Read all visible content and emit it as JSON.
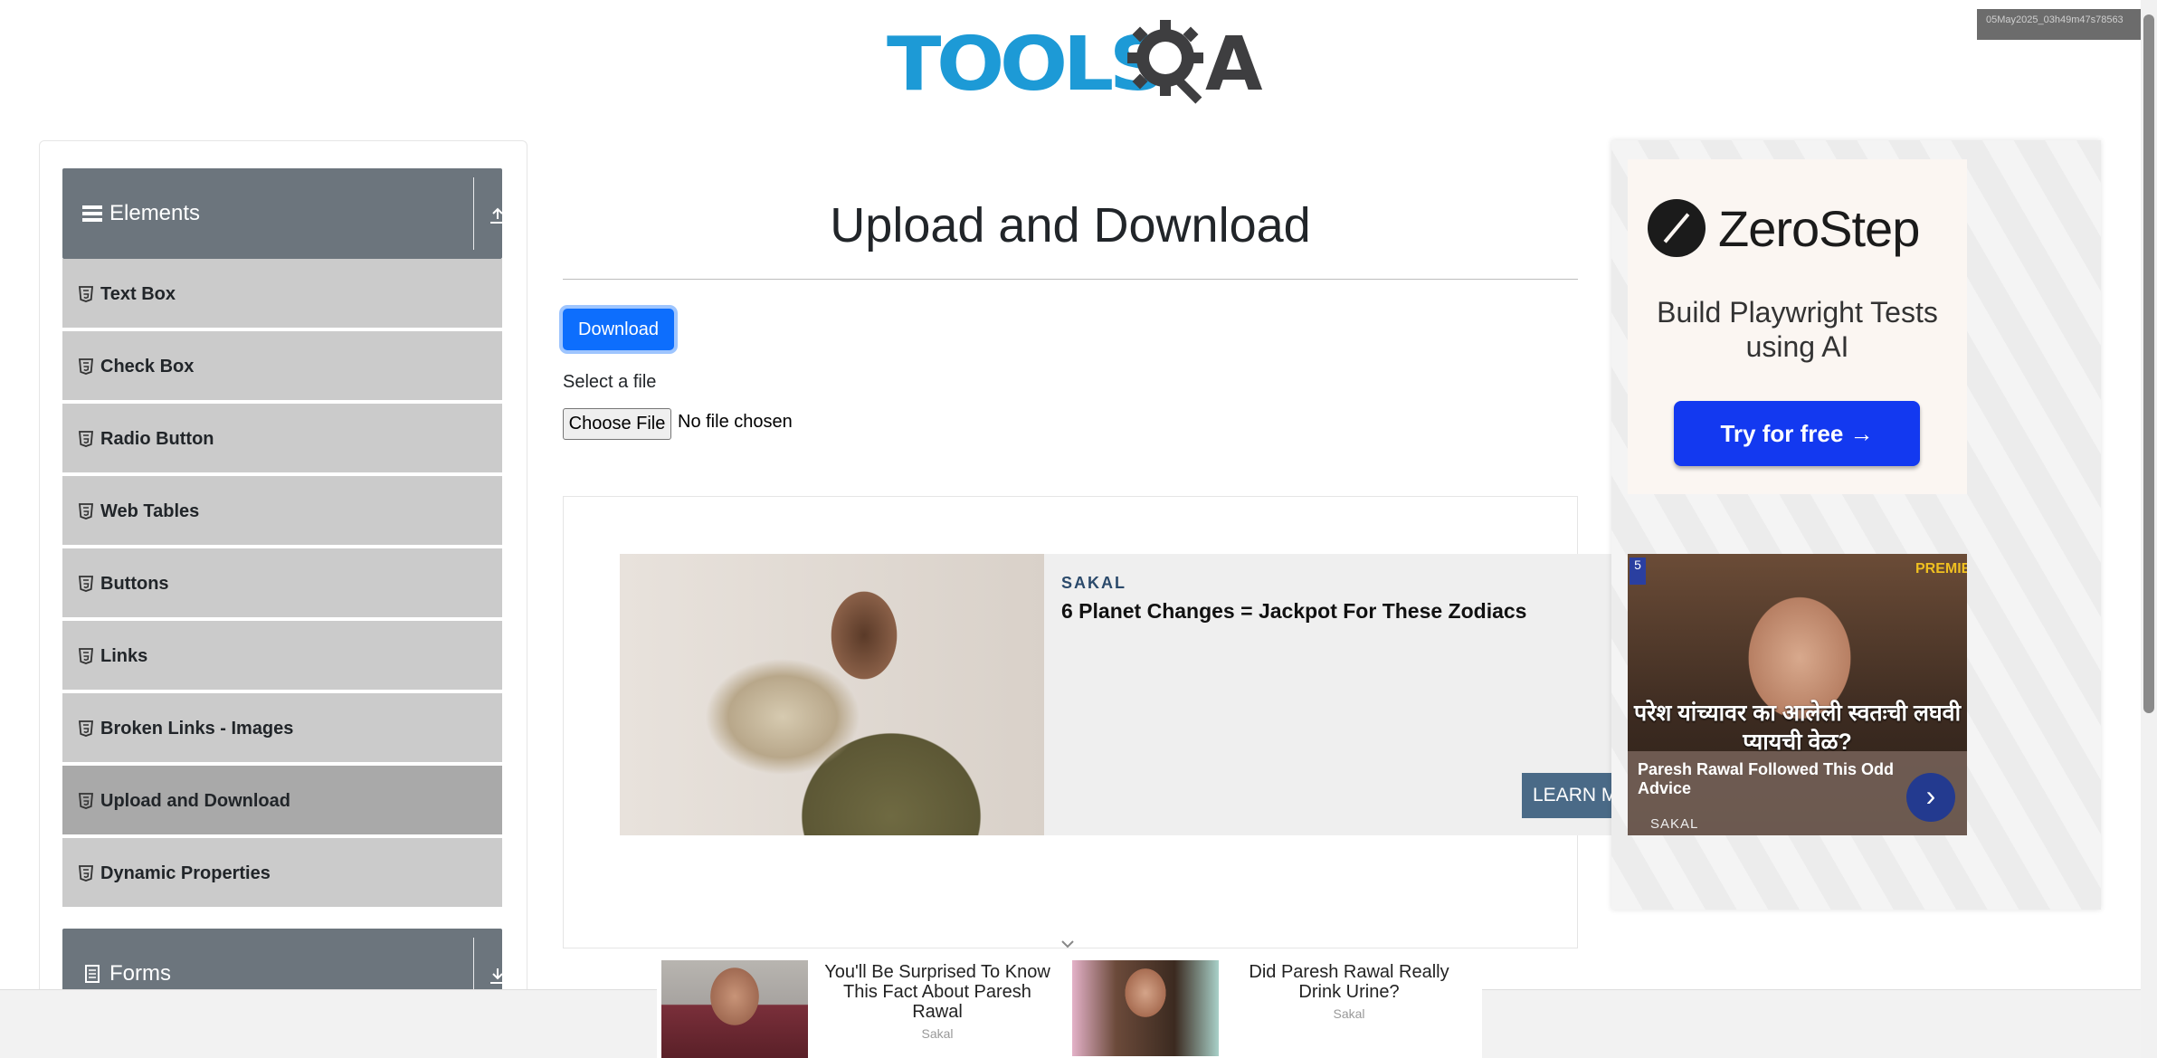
{
  "header": {
    "logo_main": "TOOLS",
    "logo_end": "A",
    "timestamp": "05May2025_03h49m47s78563"
  },
  "sidebar": {
    "elements_title": "Elements",
    "items": [
      {
        "label": "Text Box"
      },
      {
        "label": "Check Box"
      },
      {
        "label": "Radio Button"
      },
      {
        "label": "Web Tables"
      },
      {
        "label": "Buttons"
      },
      {
        "label": "Links"
      },
      {
        "label": "Broken Links - Images"
      },
      {
        "label": "Upload and Download",
        "active": true
      },
      {
        "label": "Dynamic Properties"
      }
    ],
    "forms_title": "Forms"
  },
  "main": {
    "title": "Upload and Download",
    "download_label": "Download",
    "select_label": "Select a file",
    "choose_file_label": "Choose File",
    "file_status": "No file chosen"
  },
  "ad_main": {
    "source": "SAKAL",
    "headline": "6 Planet Changes = Jackpot For These Zodiacs",
    "cta": "LEARN MORE"
  },
  "ad_zerostep": {
    "brand": "ZeroStep",
    "tagline": "Build Playwright Tests using AI",
    "cta": "Try for free →"
  },
  "ad_paresh": {
    "badge": "PREMIE",
    "number": "5",
    "overlay_text": "परेश यांच्यावर का आलेली स्वतःची लघवी प्यायची वेळ?",
    "title": "Paresh Rawal Followed This Odd Advice",
    "source": "SAKAL"
  },
  "bottom_ads": [
    {
      "title": "You'll Be Surprised To Know This Fact About Paresh Rawal",
      "source": "Sakal"
    },
    {
      "title": "Did Paresh Rawal Really Drink Urine?",
      "source": "Sakal"
    }
  ],
  "colors": {
    "accent_blue": "#0d6efd",
    "sidebar_header": "#6c757d",
    "sidebar_item": "#cbcbcb",
    "sidebar_item_active": "#a9a9a9",
    "logo_blue": "#1d9ad6",
    "zerostep_blue": "#1339f0"
  }
}
